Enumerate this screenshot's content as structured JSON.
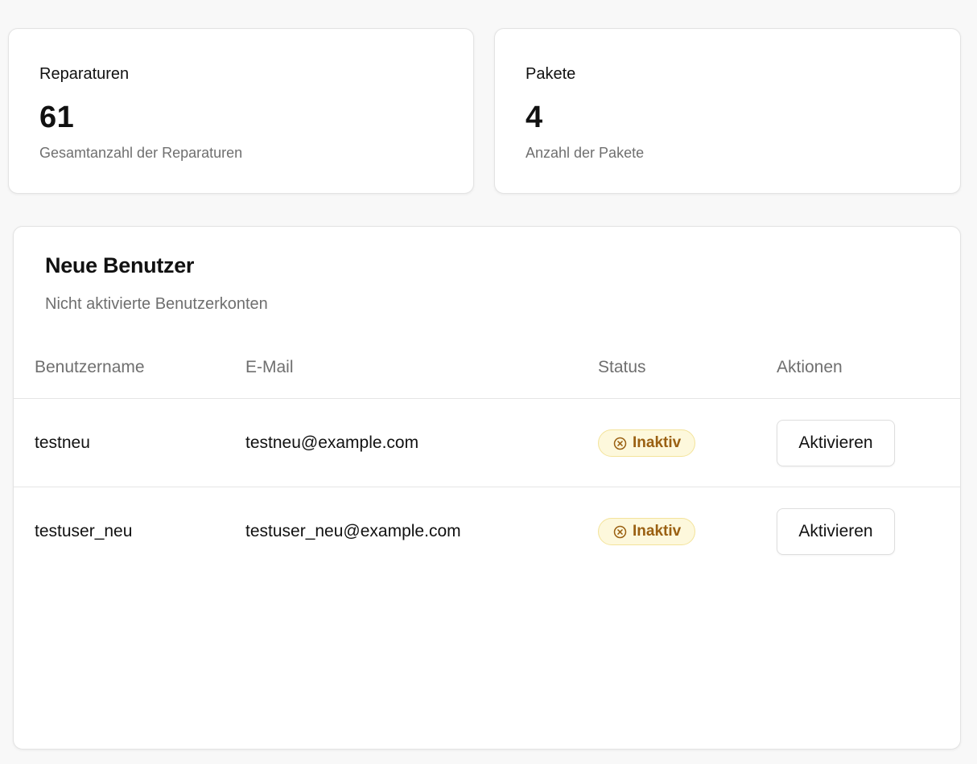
{
  "stats": {
    "repairs": {
      "title": "Reparaturen",
      "value": "61",
      "description": "Gesamtanzahl der Reparaturen"
    },
    "packages": {
      "title": "Pakete",
      "value": "4",
      "description": "Anzahl der Pakete"
    }
  },
  "new_users": {
    "title": "Neue Benutzer",
    "subtitle": "Nicht aktivierte Benutzerkonten",
    "columns": {
      "username": "Benutzername",
      "email": "E-Mail",
      "status": "Status",
      "actions": "Aktionen"
    },
    "rows": [
      {
        "username": "testneu",
        "email": "testneu@example.com",
        "status": "Inaktiv",
        "action_label": "Aktivieren"
      },
      {
        "username": "testuser_neu",
        "email": "testuser_neu@example.com",
        "status": "Inaktiv",
        "action_label": "Aktivieren"
      }
    ],
    "status_icon": "circle-x-icon"
  },
  "colors": {
    "badge_bg": "#fdf8dc",
    "badge_border": "#f3e39a",
    "badge_text": "#9a6012",
    "muted_text": "#6f6f6f"
  }
}
